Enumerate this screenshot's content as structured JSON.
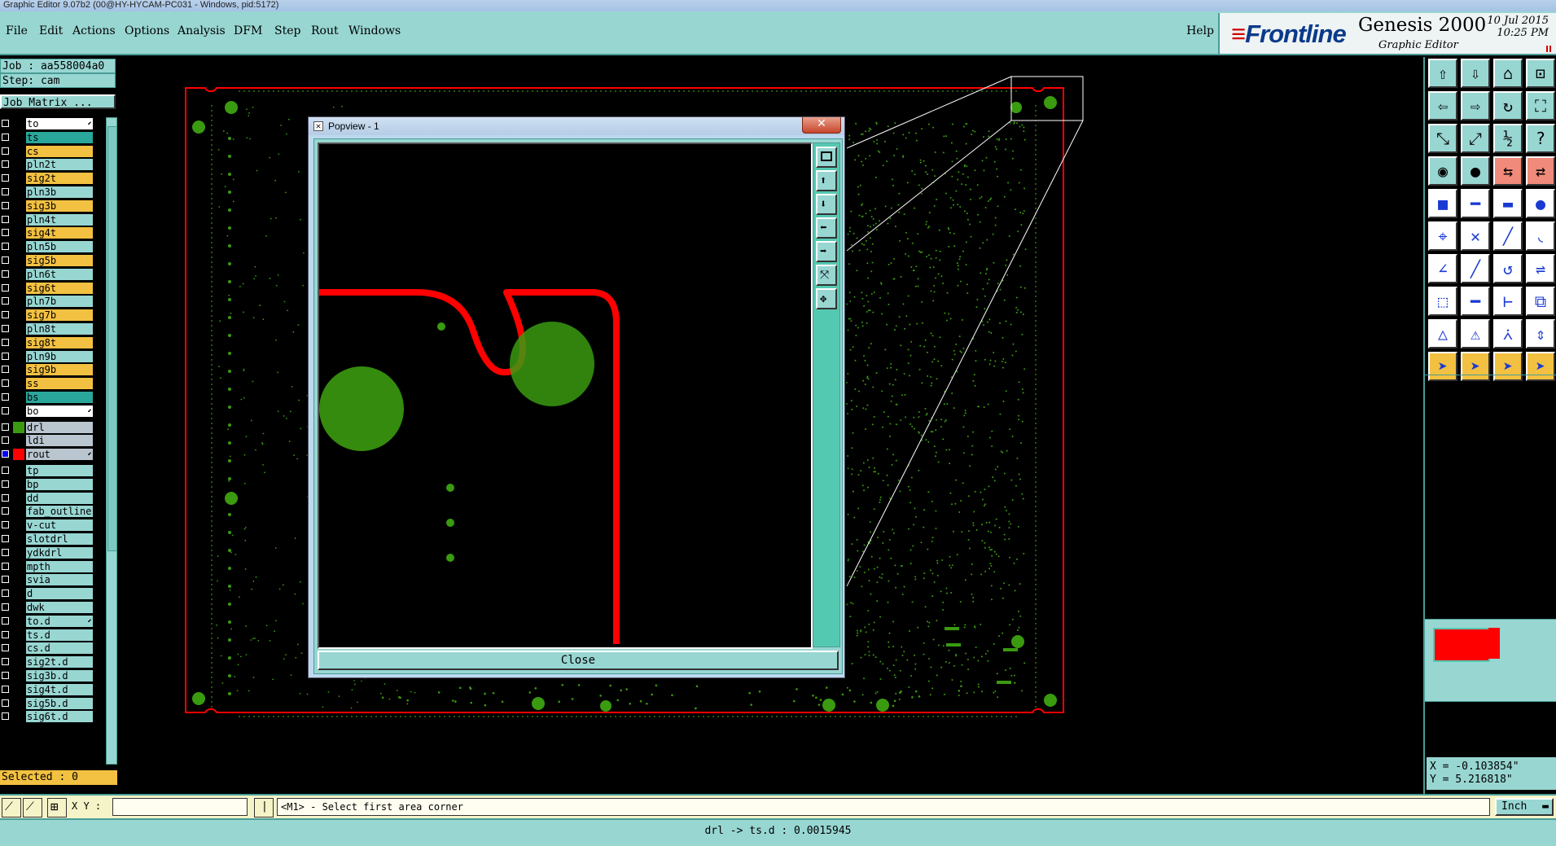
{
  "window": {
    "title": "Graphic Editor 9.07b2 (00@HY-HYCAM-PC031 - Windows, pid:5172)"
  },
  "menu": {
    "items": [
      {
        "label": "File"
      },
      {
        "label": "Edit"
      },
      {
        "label": "Actions"
      },
      {
        "label": "Options"
      },
      {
        "label": "Analysis"
      },
      {
        "label": "DFM"
      },
      {
        "label": "Step"
      },
      {
        "label": "Rout"
      },
      {
        "label": "Windows"
      }
    ],
    "help": "Help"
  },
  "branding": {
    "logo": "Frontline",
    "product": "Genesis 2000",
    "subtitle": "Graphic Editor",
    "date": "10 Jul 2015",
    "time": "10:25 PM"
  },
  "job": {
    "job_label": "Job : aa558004a0",
    "step_label": "Step: cam",
    "matrix_button": "Job Matrix ..."
  },
  "layers": [
    {
      "name": "to",
      "color": "#ffffff",
      "mark": true
    },
    {
      "name": "ts",
      "color": "#2aa79b"
    },
    {
      "name": "cs",
      "color": "#f3c141"
    },
    {
      "name": "pln2t",
      "color": "#98d6d2"
    },
    {
      "name": "sig2t",
      "color": "#f3c141"
    },
    {
      "name": "pln3b",
      "color": "#98d6d2"
    },
    {
      "name": "sig3b",
      "color": "#f3c141"
    },
    {
      "name": "pln4t",
      "color": "#98d6d2"
    },
    {
      "name": "sig4t",
      "color": "#f3c141"
    },
    {
      "name": "pln5b",
      "color": "#98d6d2"
    },
    {
      "name": "sig5b",
      "color": "#f3c141"
    },
    {
      "name": "pln6t",
      "color": "#98d6d2"
    },
    {
      "name": "sig6t",
      "color": "#f3c141"
    },
    {
      "name": "pln7b",
      "color": "#98d6d2"
    },
    {
      "name": "sig7b",
      "color": "#f3c141"
    },
    {
      "name": "pln8t",
      "color": "#98d6d2"
    },
    {
      "name": "sig8t",
      "color": "#f3c141"
    },
    {
      "name": "pln9b",
      "color": "#98d6d2"
    },
    {
      "name": "sig9b",
      "color": "#f3c141"
    },
    {
      "name": "ss",
      "color": "#f3c141"
    },
    {
      "name": "bs",
      "color": "#2aa79b"
    },
    {
      "name": "bo",
      "color": "#ffffff",
      "mark": true
    },
    {
      "name": "drl",
      "color": "#b9c5cf",
      "swatch": "#3a9a10",
      "gap": true
    },
    {
      "name": "ldi",
      "color": "#b9c5cf"
    },
    {
      "name": "rout",
      "color": "#b9c5cf",
      "swatch": "#ff0000",
      "active": true,
      "mark": true
    },
    {
      "name": "tp",
      "color": "#98d6d2",
      "gap": true
    },
    {
      "name": "bp",
      "color": "#98d6d2"
    },
    {
      "name": "dd",
      "color": "#98d6d2"
    },
    {
      "name": "fab_outline",
      "color": "#98d6d2"
    },
    {
      "name": "v-cut",
      "color": "#98d6d2"
    },
    {
      "name": "slotdrl",
      "color": "#98d6d2"
    },
    {
      "name": "ydkdrl",
      "color": "#98d6d2"
    },
    {
      "name": "mpth",
      "color": "#98d6d2"
    },
    {
      "name": "svia",
      "color": "#98d6d2"
    },
    {
      "name": "d",
      "color": "#98d6d2"
    },
    {
      "name": "dwk",
      "color": "#98d6d2"
    },
    {
      "name": "to.d",
      "color": "#98d6d2",
      "mark": true
    },
    {
      "name": "ts.d",
      "color": "#98d6d2"
    },
    {
      "name": "cs.d",
      "color": "#98d6d2"
    },
    {
      "name": "sig2t.d",
      "color": "#98d6d2"
    },
    {
      "name": "sig3b.d",
      "color": "#98d6d2"
    },
    {
      "name": "sig4t.d",
      "color": "#98d6d2"
    },
    {
      "name": "sig5b.d",
      "color": "#98d6d2"
    },
    {
      "name": "sig6t.d",
      "color": "#98d6d2"
    }
  ],
  "selected": "Selected : 0",
  "popview": {
    "title": "Popview - 1",
    "close_label": "Close",
    "close_x": "✕"
  },
  "coords": {
    "x": "X = -0.103854\"",
    "y": "Y =  5.216818\""
  },
  "status": {
    "xy_label": "X Y :",
    "xy_value": "",
    "prompt": "<M1> - Select first area corner",
    "units": "Inch"
  },
  "measure": "drl -> ts.d : 0.0015945",
  "colors": {
    "board_outline": "#ff0000",
    "drill": "#3a9a10",
    "panel": "#98d6d2",
    "highlight": "#f3c141"
  }
}
